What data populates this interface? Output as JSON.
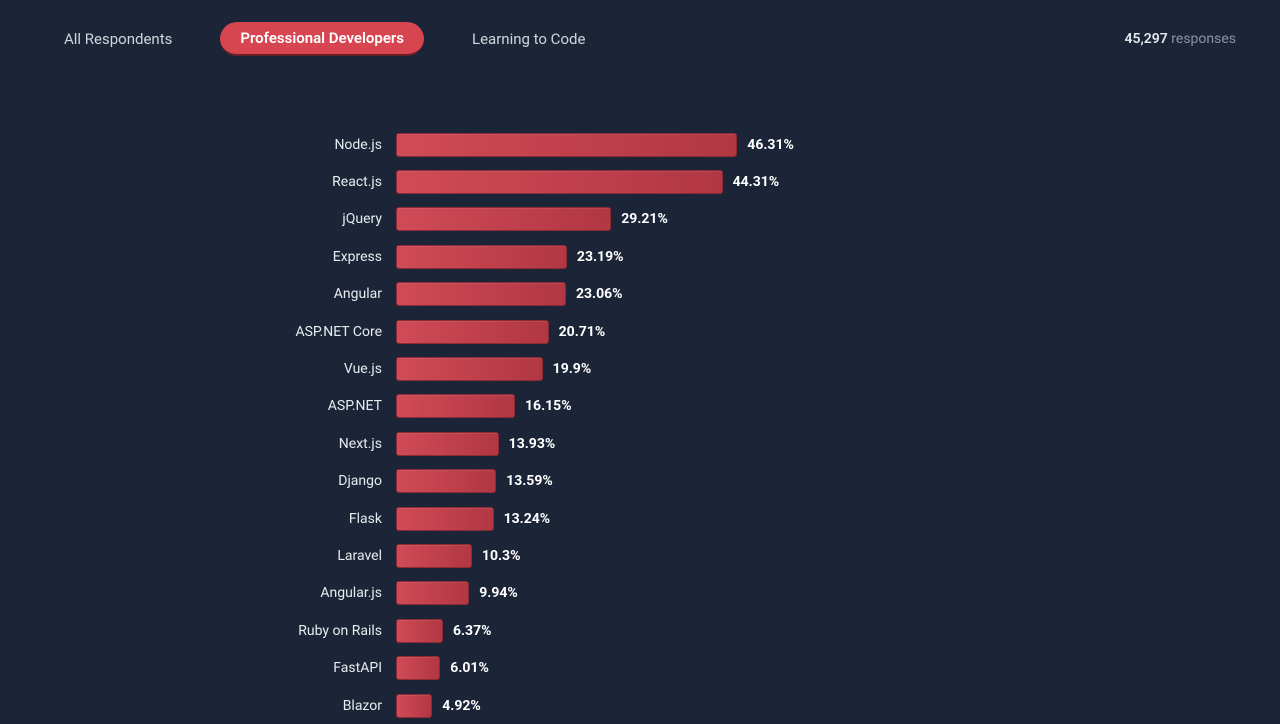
{
  "tabs": {
    "all": "All Respondents",
    "pro": "Professional Developers",
    "learn": "Learning to Code",
    "active": "pro"
  },
  "responses": {
    "count": "45,297",
    "suffix": "responses"
  },
  "chart_data": {
    "type": "bar",
    "orientation": "horizontal",
    "title": "",
    "xlabel": "",
    "ylabel": "",
    "xlim": [
      0,
      100
    ],
    "unit": "%",
    "categories": [
      "Node.js",
      "React.js",
      "jQuery",
      "Express",
      "Angular",
      "ASP.NET Core",
      "Vue.js",
      "ASP.NET",
      "Next.js",
      "Django",
      "Flask",
      "Laravel",
      "Angular.js",
      "Ruby on Rails",
      "FastAPI",
      "Blazor"
    ],
    "values": [
      46.31,
      44.31,
      29.21,
      23.19,
      23.06,
      20.71,
      19.9,
      16.15,
      13.93,
      13.59,
      13.24,
      10.3,
      9.94,
      6.37,
      6.01,
      4.92
    ],
    "value_labels": [
      "46.31%",
      "44.31%",
      "29.21%",
      "23.19%",
      "23.06%",
      "20.71%",
      "19.9%",
      "16.15%",
      "13.93%",
      "13.59%",
      "13.24%",
      "10.3%",
      "9.94%",
      "6.37%",
      "6.01%",
      "4.92%"
    ]
  }
}
